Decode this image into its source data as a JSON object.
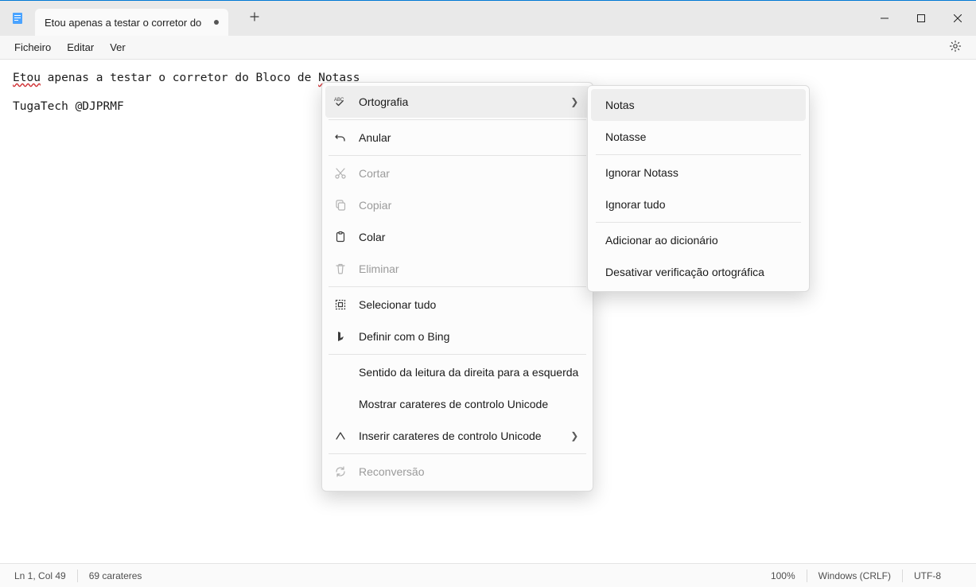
{
  "window": {
    "tab_title": "Etou apenas a testar o corretor do"
  },
  "menubar": {
    "file": "Ficheiro",
    "edit": "Editar",
    "view": "Ver"
  },
  "editor": {
    "word1_err": "Etou",
    "segment1": " apenas a testar o corretor do Bloco de ",
    "word2_err": "Notass",
    "line3": "TugaTech @DJPRMF"
  },
  "context_menu": {
    "ortografia": "Ortografia",
    "anular": "Anular",
    "cortar": "Cortar",
    "copiar": "Copiar",
    "colar": "Colar",
    "eliminar": "Eliminar",
    "selecionar_tudo": "Selecionar tudo",
    "bing": "Definir com o Bing",
    "rtl": "Sentido da leitura da direita para a esquerda",
    "show_unicode": "Mostrar carateres de controlo Unicode",
    "insert_unicode": "Inserir carateres de controlo Unicode",
    "reconversao": "Reconversão"
  },
  "spell_submenu": {
    "sugg1": "Notas",
    "sugg2": "Notasse",
    "ignore_word": "Ignorar Notass",
    "ignore_all": "Ignorar tudo",
    "add_dict": "Adicionar ao dicionário",
    "disable": "Desativar verificação ortográfica"
  },
  "statusbar": {
    "position": "Ln 1, Col 49",
    "chars": "69 carateres",
    "zoom": "100%",
    "eol": "Windows (CRLF)",
    "encoding": "UTF-8"
  }
}
